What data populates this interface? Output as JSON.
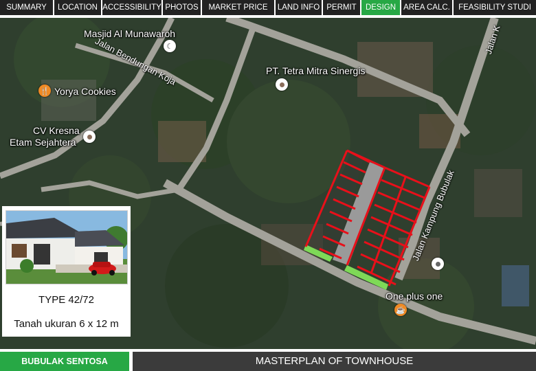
{
  "tabs": [
    {
      "label": "SUMMARY",
      "active": false
    },
    {
      "label": "LOCATION",
      "active": false
    },
    {
      "label": "ACCESSIBILITY",
      "active": false
    },
    {
      "label": "PHOTOS",
      "active": false
    },
    {
      "label": "MARKET PRICE",
      "active": false
    },
    {
      "label": "LAND INFO",
      "active": false
    },
    {
      "label": "PERMIT",
      "active": false
    },
    {
      "label": "DESIGN",
      "active": true
    },
    {
      "label": "AREA CALC.",
      "active": false
    },
    {
      "label": "FEASIBILITY  STUDI",
      "active": false
    }
  ],
  "map": {
    "pois": {
      "masjid": "Masjid Al Munawaroh",
      "tetra": "PT. Tetra Mitra Sinergis",
      "yorya": "Yorya Cookies",
      "kresna_line1": "CV Kresna",
      "kresna_line2": "Etam Sejahtera",
      "oneplus": "One plus one"
    },
    "roads": {
      "bendungan": "Jalan Bendungan Koja",
      "kampung": "Jalan Kampung Bubulak",
      "jalan_corner": "Jalan K"
    },
    "colors": {
      "plot_lines": "#e8101a",
      "access_road": "#9a9a9a",
      "green_strip": "#7ed957"
    }
  },
  "card": {
    "type": "TYPE 42/72",
    "size": "Tanah ukuran 6 x 12 m"
  },
  "footer": {
    "left": "BUBULAK SENTOSA",
    "right": "MASTERPLAN OF TOWNHOUSE"
  }
}
